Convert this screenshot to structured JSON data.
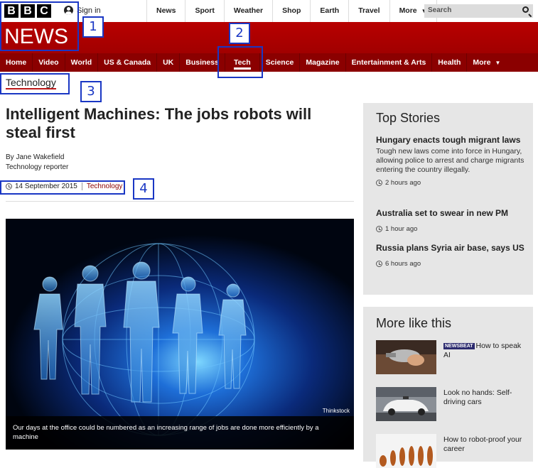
{
  "brand": {
    "letters": [
      "B",
      "B",
      "C"
    ],
    "sign_in": "Sign in",
    "section_title": "NEWS"
  },
  "top_nav": [
    "News",
    "Sport",
    "Weather",
    "Shop",
    "Earth",
    "Travel"
  ],
  "top_nav_more": "More",
  "search": {
    "placeholder": "Search"
  },
  "main_nav": {
    "items": [
      "Home",
      "Video",
      "World",
      "US & Canada",
      "UK",
      "Business",
      "Tech",
      "Science",
      "Magazine",
      "Entertainment & Arts",
      "Health"
    ],
    "more": "More",
    "active": "Tech"
  },
  "section_label": "Technology",
  "annotations": [
    "1",
    "2",
    "3",
    "4"
  ],
  "article": {
    "headline": "Intelligent Machines: The jobs robots will steal first",
    "author": "By Jane Wakefield",
    "author_role": "Technology reporter",
    "date": "14 September 2015",
    "category": "Technology",
    "image_credit": "Thinkstock",
    "image_caption": "Our days at the office could be numbered as an increasing range of jobs are done more efficiently by a machine"
  },
  "top_stories": {
    "title": "Top Stories",
    "items": [
      {
        "headline": "Hungary enacts tough migrant laws",
        "summary": "Tough new laws come into force in Hungary, allowing police to arrest and charge migrants entering the country illegally.",
        "time": "2 hours ago"
      },
      {
        "headline": "Australia set to swear in new PM",
        "summary": "",
        "time": "1 hour ago"
      },
      {
        "headline": "Russia plans Syria air base, says US",
        "summary": "",
        "time": "6 hours ago"
      }
    ]
  },
  "more_like_this": {
    "title": "More like this",
    "items": [
      {
        "badge": "NEWSBEAT",
        "text": "How to speak AI"
      },
      {
        "badge": "",
        "text": "Look no hands: Self-driving cars"
      },
      {
        "badge": "",
        "text": "How to robot-proof your career"
      }
    ]
  },
  "colors": {
    "brand_red": "#bb1919",
    "nav_dark_red": "#8b0000",
    "annotation_blue": "#1a37c4"
  }
}
